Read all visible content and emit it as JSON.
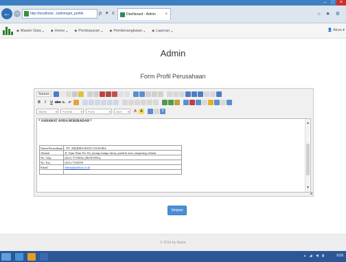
{
  "window": {
    "minimize": "–",
    "maximize": "□",
    "close": "×"
  },
  "browser": {
    "back": "←",
    "forward": "→",
    "url": "http://localhost/.../admin/get_profile",
    "address_tools": "ρ ▾ c",
    "tab_title": "Dashboard - Admin",
    "tab_close": "×",
    "toolbar_icons": "⌂ ★ ⚙"
  },
  "appnav": {
    "menu": [
      {
        "label": "Master Data"
      },
      {
        "label": "Home"
      },
      {
        "label": "Pembayaran"
      },
      {
        "label": "Pemberangkatan"
      },
      {
        "label": "Laporan"
      }
    ],
    "user": "Akun"
  },
  "page": {
    "title": "Admin",
    "form_title": "Form Profil Perusahaan"
  },
  "editor": {
    "source_label": "Source",
    "styles_label": "Styles",
    "format_label": "Format",
    "font_label": "Font",
    "size_label": "Size",
    "greeting": "* SAHABAT ANDA BERIBADAH *",
    "rows": [
      {
        "label": "Nama Perusahaan",
        "value": ": PT. ARQIMA BAYU NUSABA"
      },
      {
        "label": "Alamat",
        "value": "Jl. Ujan Nam No. 63, jarang mangu timur, pondok aren, tangerang selatan"
      },
      {
        "label": "No. Telp",
        "value": "(021) 7572804, (HUNTING)"
      },
      {
        "label": "No. Fax",
        "value": "(021) 7552059"
      },
      {
        "label": "Email",
        "value": "alrima@yahoo.co.id"
      },
      {
        "label": "",
        "value": ""
      }
    ]
  },
  "simpan_label": "Simpan",
  "footer": "© 2014 by Bedar",
  "taskbar": {
    "tray": "▴ ◢ ◀ ▮",
    "clock": "9:09"
  },
  "colors": {
    "titlebar": "#3e7fc1",
    "taskbar": "#2b5797",
    "button": "#4a8fd4",
    "link": "#1a3fcc"
  }
}
